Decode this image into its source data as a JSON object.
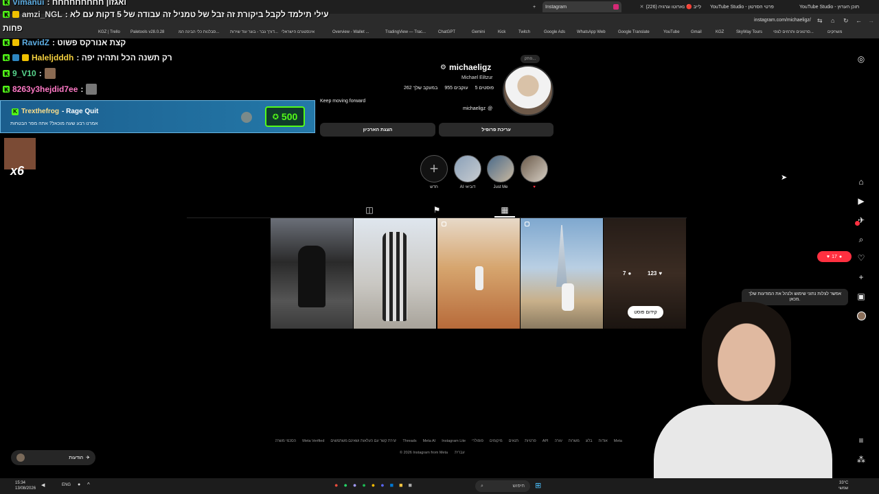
{
  "browser": {
    "tabs": [
      {
        "label": "Instagram"
      },
      {
        "label": "לייב 🔴 נארוטו וגרגיה (226)"
      },
      {
        "label": "YouTube Studio - פרטי הסרטון"
      },
      {
        "label": "YouTube Studio - תוכן הערוץ"
      }
    ],
    "url": "instagram.com/michaeligz/",
    "bookmarks": [
      "KGZ | Trello",
      "Paletools v28.0.28",
      "סבלנות כלי הבינה המ...",
      "דורך גבר - בוגר עוד שירות...",
      "אינסטגרם הישראלי",
      "Overview - Wallet ...",
      "TradingView — Trac...",
      "ChatGPT",
      "Gemini",
      "Kick",
      "Twitch",
      "Google Ads",
      "WhatsApp Web",
      "Google Translate",
      "YouTube",
      "Gmail",
      "KGZ",
      "SkyWay Tours",
      "סרטונים ותרמים לצפי...",
      "משחקים"
    ]
  },
  "chat": {
    "messages": [
      {
        "user": "Vimanui",
        "text": ": ואגזון חחחחחחחחח"
      },
      {
        "user": "amzi_NGL",
        "text": ": עילי תילמד לקבל ביקורת זה זבל של טמניל זה עבודה של 5 דקות עם לא"
      },
      {
        "user": "",
        "text": "פחות"
      },
      {
        "user": "RavidZ",
        "text": ": קצת אנורקס פשוט"
      },
      {
        "user": "Haleljdddh",
        "text": ": רק תשנה הכל ותהיה יפה"
      },
      {
        "user": "9_V10",
        "text": ":"
      },
      {
        "user": "8263y3hejdid7ee",
        "text": ":"
      }
    ],
    "alert": {
      "user": "Trexthefrog",
      "title": "- Rage Quit",
      "subtitle": "אמרנו רבע שעה מוכאל? אתה מפר הבטחות",
      "amount": "500"
    },
    "emote_multiplier": "x6"
  },
  "profile": {
    "username": "michaeligz",
    "full_name": "Michael Eiltzur",
    "posts": "5 פוסטים",
    "followers": "955 עוקבים",
    "following": "262 במעקב שלך",
    "bio": "Keep moving forward",
    "threads_handle": "michaeligz",
    "note_label": "פתק...",
    "edit_profile": "עריכת פרופיל",
    "archive": "הצגת הארכיון"
  },
  "highlights": [
    {
      "label": "חדש"
    },
    {
      "label": "AI דוביאי"
    },
    {
      "label": "Just Me"
    },
    {
      "label": "♥"
    }
  ],
  "post_overlay": {
    "likes": "123",
    "comments": "7",
    "boost": "קידום פוסט"
  },
  "sidebar": {
    "notification_count": "17",
    "tooltip": "אפשר לצלות נתוני שימוש ולנהל את המודעות שלך מכאן."
  },
  "footer": {
    "links": [
      "Meta",
      "אודות",
      "בלוג",
      "משרות",
      "עזרה",
      "API",
      "פרטיות",
      "תנאים",
      "מיקומים",
      "פופולרי",
      "Instagram Lite",
      "Meta AI",
      "Threads",
      "יצירת קשר עם העלאות ושאינם משתמשים",
      "Meta Verified",
      "הסכמי משרה"
    ],
    "language": "עברית",
    "copyright": "© 2026 Instagram from Meta"
  },
  "messages_button": {
    "label": "הודעות"
  },
  "taskbar": {
    "time": "15:34",
    "date": "13/08/2026",
    "lang": "ENG",
    "search_placeholder": "חיפוש",
    "weather_temp": "33°C",
    "weather_text": "שמשי"
  },
  "colors": {
    "kick_green": "#53fc18",
    "ig_like": "#ff3040",
    "alert_blue": "#1d6fa5"
  }
}
